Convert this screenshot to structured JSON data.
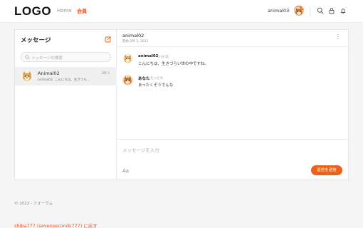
{
  "header": {
    "logo": "LOGO",
    "nav": {
      "home": "Home",
      "member": "会員"
    },
    "user": {
      "name": "animal03",
      "chevron": "⌄",
      "badge": "2"
    },
    "icons": [
      "search-icon",
      "lock-icon",
      "bell-icon"
    ]
  },
  "sidebar": {
    "title": "メッセージ",
    "search_placeholder": "メッセージの検索",
    "conversations": [
      {
        "name": "Animal02",
        "time": "2時 3",
        "preview": "animal02: こんにちは、生きづら..."
      }
    ]
  },
  "chat": {
    "title": "animal02",
    "subtitle": "開始 2時 3, 2022",
    "menu": "⋮",
    "messages": [
      {
        "sender": "animal02",
        "time": "2 分 前",
        "text": "こんにちは、生きづらい世の中ですね。"
      },
      {
        "sender": "あなた",
        "time": "たった今",
        "text": "まったくそうでんな"
      }
    ],
    "composer": {
      "placeholder": "メッセージを入力",
      "font_label": "Aa",
      "send_label": "返信を送信"
    }
  },
  "footer": {
    "copyright": "© 2022 - フォーラム",
    "back_link": "shiba777 (sevenseconds777) に戻す"
  },
  "colors": {
    "accent": "#e9631a",
    "link": "#e8552b",
    "background": "#f5f5f5"
  }
}
